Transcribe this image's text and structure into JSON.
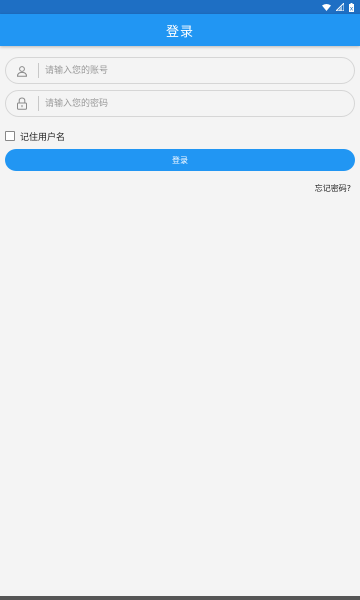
{
  "header": {
    "title": "登录"
  },
  "login_form": {
    "account_placeholder": "请输入您的账号",
    "password_placeholder": "请输入您的密码",
    "remember_label": "记住用户名",
    "remember_checked": false,
    "login_label": "登录",
    "forgot_label": "忘记密码?"
  },
  "icons": {
    "account": "user-icon",
    "password": "lock-icon",
    "status": [
      "wifi-icon",
      "signal-icon",
      "battery-icon"
    ]
  },
  "colors": {
    "primary": "#2196f3",
    "status_bar": "#1e6fc4",
    "background": "#f4f4f4"
  }
}
